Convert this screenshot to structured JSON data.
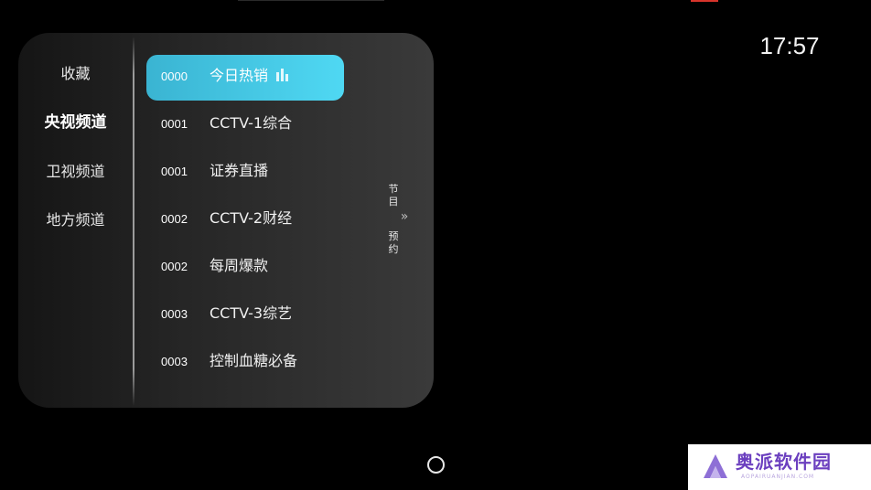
{
  "status": {
    "time": "17:57"
  },
  "categories": [
    {
      "label": "收藏",
      "active": false
    },
    {
      "label": "央视频道",
      "active": true
    },
    {
      "label": "卫视频道",
      "active": false
    },
    {
      "label": "地方频道",
      "active": false
    }
  ],
  "channels": [
    {
      "number": "0000",
      "name": "今日热销",
      "selected": true,
      "playing": true
    },
    {
      "number": "0001",
      "name": "CCTV-1综合",
      "selected": false
    },
    {
      "number": "0001",
      "name": "证券直播",
      "selected": false
    },
    {
      "number": "0002",
      "name": "CCTV-2财经",
      "selected": false
    },
    {
      "number": "0002",
      "name": "每周爆款",
      "selected": false
    },
    {
      "number": "0003",
      "name": "CCTV-3综艺",
      "selected": false
    },
    {
      "number": "0003",
      "name": "控制血糖必备",
      "selected": false
    }
  ],
  "side_tab": {
    "chars": [
      "节",
      "目",
      "预",
      "约"
    ],
    "arrow": "»"
  },
  "watermark": {
    "text": "奥派软件园",
    "sub": "AOPAIRUANJIAN.COM"
  },
  "colors": {
    "background": "#000000",
    "selected_row": "#4fd8f3",
    "text": "#f0f0f0",
    "watermark_accent": "#6b3fbf"
  },
  "icons": {
    "playing_indicator": "equalizer-icon",
    "home": "home-circle-icon",
    "expand": "double-chevron-right-icon"
  }
}
